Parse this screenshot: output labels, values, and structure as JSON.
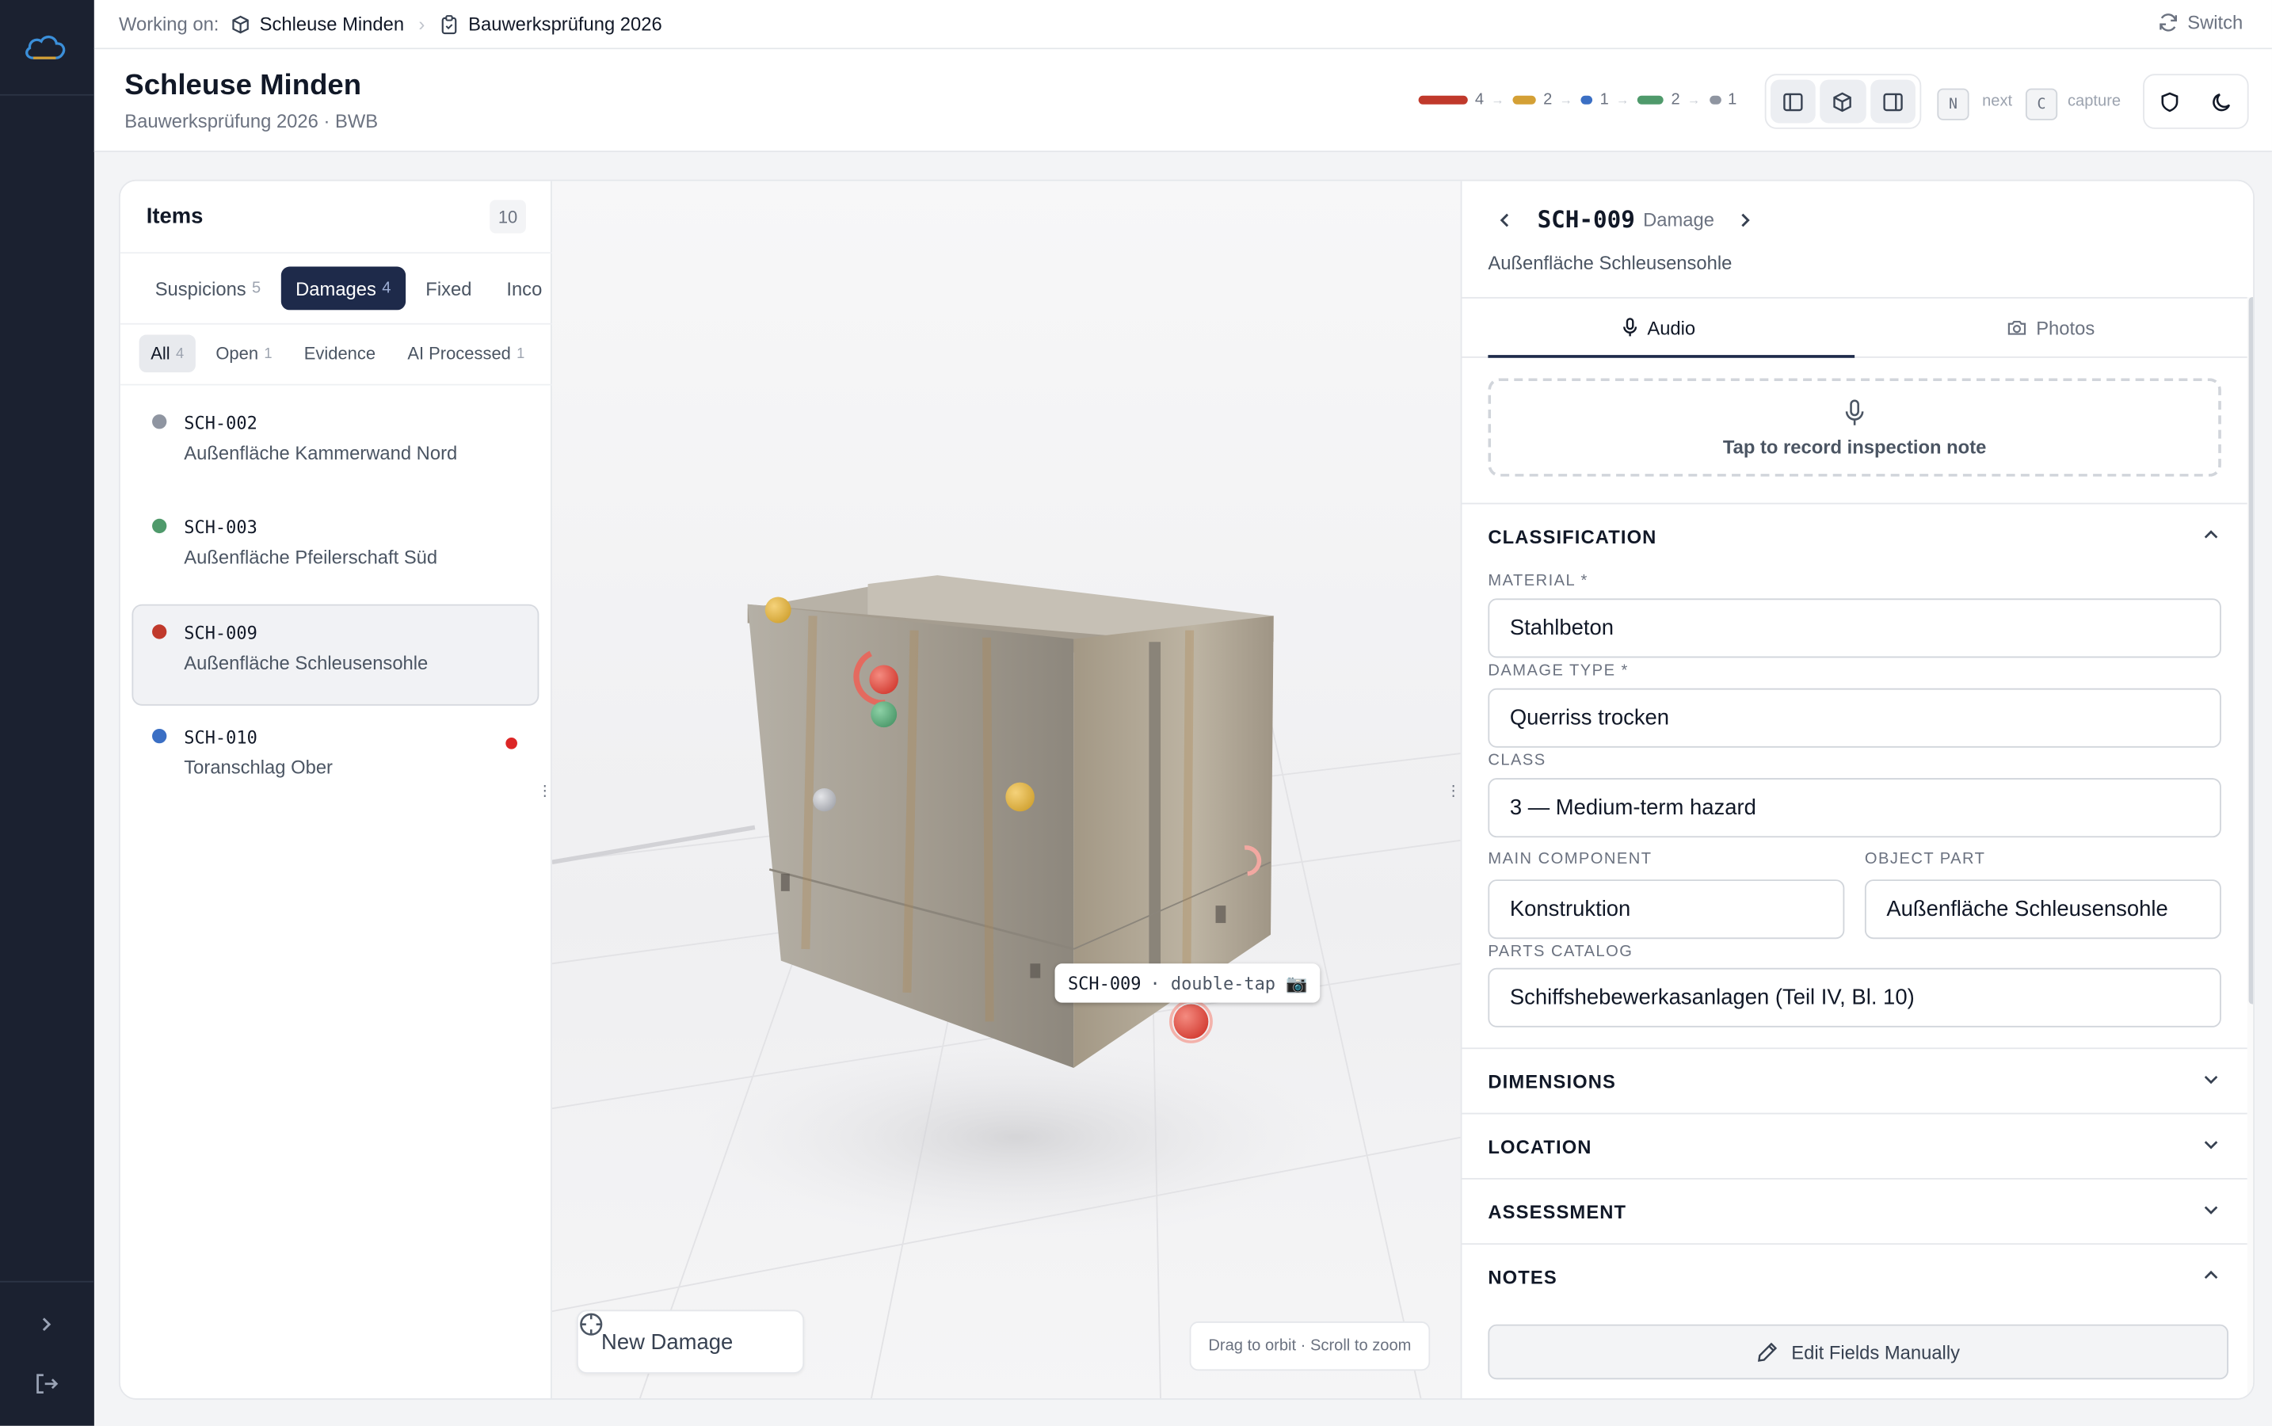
{
  "topbar": {
    "working_on": "Working on:",
    "project": "Schleuse Minden",
    "inspection": "Bauwerksprüfung 2026",
    "switch_label": "Switch"
  },
  "header": {
    "title": "Schleuse Minden",
    "subtitle": "Bauwerksprüfung 2026 · BWB",
    "legend": [
      {
        "count": "4",
        "color": "#c0392b"
      },
      {
        "count": "2",
        "color": "#d4a035"
      },
      {
        "count": "1",
        "color": "#3b6fc4"
      },
      {
        "count": "2",
        "color": "#4f9a6b"
      },
      {
        "count": "1",
        "color": "#8f95a1"
      }
    ],
    "kbd_next": "N",
    "next_label": "next",
    "kbd_capture": "C",
    "capture_label": "capture"
  },
  "items": {
    "title": "Items",
    "count": "10",
    "tabs": [
      {
        "label": "Suspicions",
        "count": "5"
      },
      {
        "label": "Damages",
        "count": "4"
      },
      {
        "label": "Fixed",
        "count": ""
      },
      {
        "label": "Inco",
        "count": ""
      }
    ],
    "subtabs": [
      {
        "label": "All",
        "count": "4"
      },
      {
        "label": "Open",
        "count": "1"
      },
      {
        "label": "Evidence",
        "count": ""
      },
      {
        "label": "AI Processed",
        "count": "1"
      }
    ],
    "rows": [
      {
        "id": "SCH-002",
        "desc": "Außenfläche Kammerwand Nord",
        "color": "#8f95a1"
      },
      {
        "id": "SCH-003",
        "desc": "Außenfläche Pfeilerschaft Süd",
        "color": "#4f9a6b"
      },
      {
        "id": "SCH-009",
        "desc": "Außenfläche Schleusensohle",
        "color": "#c0392b"
      },
      {
        "id": "SCH-010",
        "desc": "Toranschlag Ober",
        "color": "#3b6fc4"
      }
    ]
  },
  "viewer": {
    "tooltip_id": "SCH-009",
    "tooltip_hint": "· double-tap 📷",
    "new_damage": "New Damage",
    "orbit_hint": "Drag to orbit · Scroll to zoom"
  },
  "detail": {
    "id": "SCH-009",
    "type": "Damage",
    "part": "Außenfläche Schleusensohle",
    "tab_audio": "Audio",
    "tab_photos": "Photos",
    "record_label": "Tap to record inspection note",
    "classification": "CLASSIFICATION",
    "material_label": "MATERIAL *",
    "material": "Stahlbeton",
    "damage_type_label": "DAMAGE TYPE *",
    "damage_type": "Querriss trocken",
    "class_label": "CLASS",
    "class_value": "3 — Medium-term hazard",
    "main_component_label": "MAIN COMPONENT",
    "main_component": "Konstruktion",
    "object_part_label": "OBJECT PART",
    "object_part": "Außenfläche Schleusensohle",
    "parts_catalog_label": "PARTS CATALOG",
    "parts_catalog": "Schiffshebewerkasanlagen (Teil IV, Bl. 10)",
    "dimensions": "DIMENSIONS",
    "location": "LOCATION",
    "assessment": "ASSESSMENT",
    "notes": "NOTES",
    "edit_fields": "Edit Fields Manually"
  }
}
